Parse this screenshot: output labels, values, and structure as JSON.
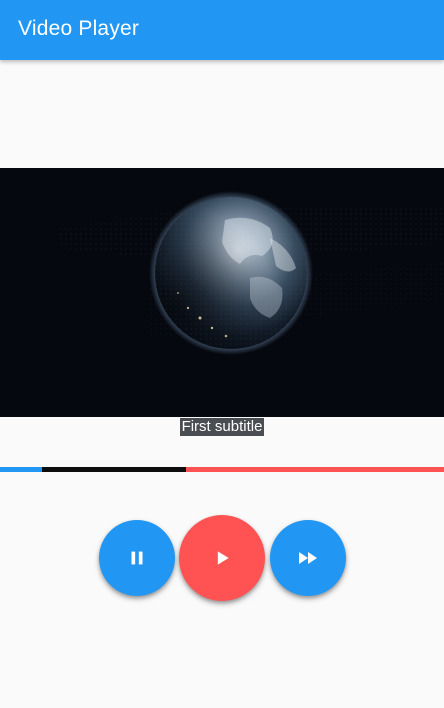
{
  "appbar": {
    "title": "Video Player",
    "color": "#2196f3"
  },
  "video": {
    "content": "earth-from-space",
    "subtitle": "First subtitle"
  },
  "progress": {
    "played_fraction": 0.095,
    "buffered_fraction": 0.42,
    "played_color": "#2196f3",
    "buffered_color": "#0d0d0d",
    "remaining_color": "#ff5252"
  },
  "controls": {
    "pause_icon": "pause-icon",
    "play_icon": "play-icon",
    "forward_icon": "fast-forward-icon",
    "button_color": "#2196f3",
    "play_color": "#ff5252"
  }
}
